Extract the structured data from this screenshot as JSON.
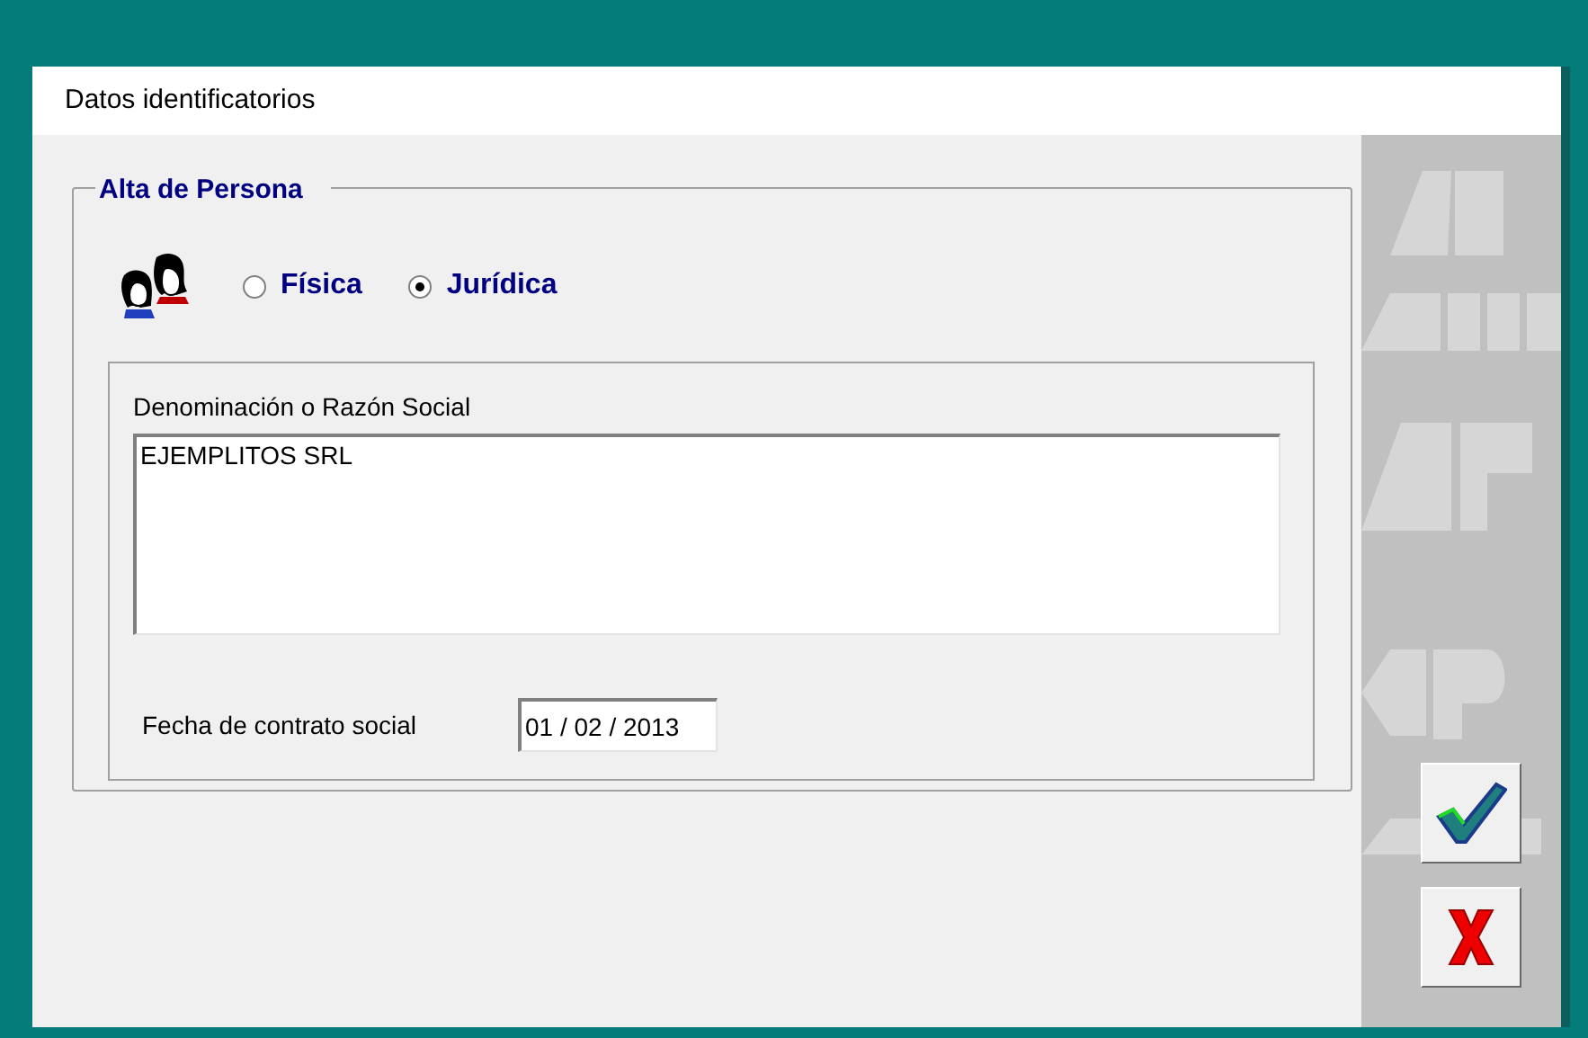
{
  "window": {
    "title": "Datos identificatorios"
  },
  "group": {
    "title": "Alta de Persona"
  },
  "person_type": [
    {
      "label": "Física",
      "selected": false
    },
    {
      "label": "Jurídica",
      "selected": true
    }
  ],
  "name_field": {
    "label": "Denominación o Razón Social",
    "value": "EJEMPLITOS SRL"
  },
  "date_field": {
    "label": "Fecha de contrato social",
    "value": "01 / 02 / 2013"
  }
}
